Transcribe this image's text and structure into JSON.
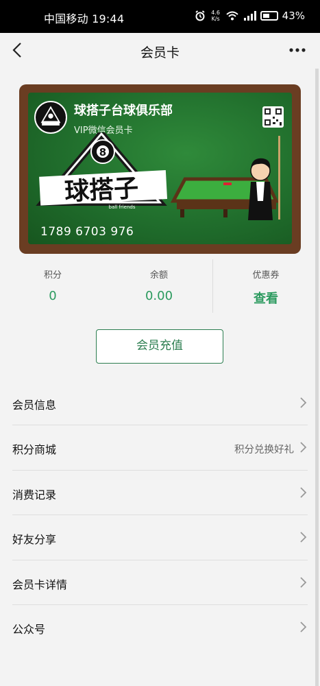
{
  "status_bar": {
    "left_text": "中国移动 19:44",
    "speed_top": "4.6",
    "speed_bottom": "K/s",
    "battery": "43%"
  },
  "nav": {
    "title": "会员卡",
    "back_icon": "chevron-left-icon",
    "more_icon": "more-dots-icon"
  },
  "card": {
    "club_name": "球搭子台球俱乐部",
    "subtitle": "VIP微信会员卡",
    "number": "1789 6703 976",
    "art_text": "球搭子",
    "art_small": "ball friends",
    "colors": {
      "wood": "#6a3d22",
      "felt": "#237a30"
    }
  },
  "stats": [
    {
      "label": "积分",
      "value": "0"
    },
    {
      "label": "余额",
      "value": "0.00"
    },
    {
      "label": "优惠券",
      "value": "查看"
    }
  ],
  "recharge_label": "会员充值",
  "menu": [
    {
      "label": "会员信息",
      "note": ""
    },
    {
      "label": "积分商城",
      "note": "积分兑换好礼"
    },
    {
      "label": "消费记录",
      "note": ""
    },
    {
      "label": "好友分享",
      "note": ""
    },
    {
      "label": "会员卡详情",
      "note": ""
    },
    {
      "label": "公众号",
      "note": ""
    }
  ],
  "accent_color": "#2b9a5e"
}
